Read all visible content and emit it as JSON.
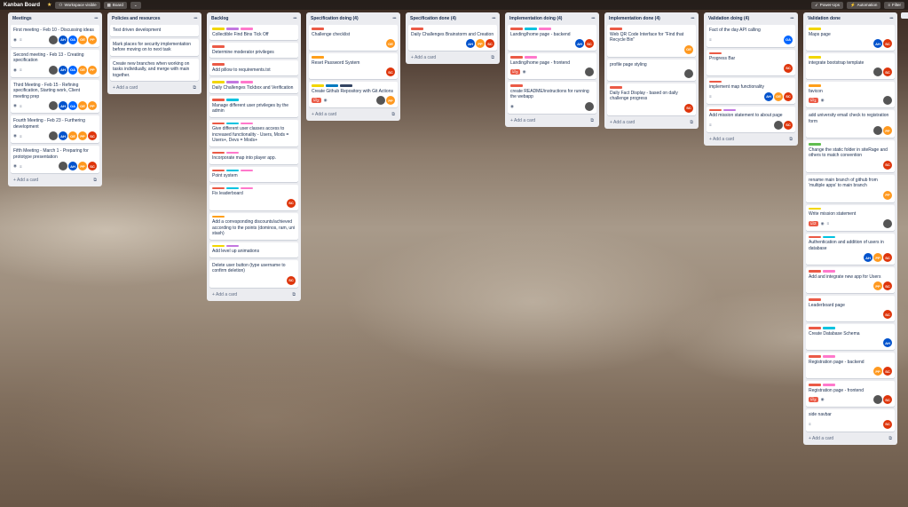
{
  "topbar": {
    "title": "Kanban Board",
    "workspace": "Workspace visible",
    "board": "Board",
    "powerups": "Power-Ups",
    "automation": "Automation",
    "filter": "Filter",
    "add": "+ A"
  },
  "labels": {
    "red": "#eb5a46",
    "yellow": "#f2d600",
    "purple": "#c377e0",
    "pink": "#ff78cb",
    "blue": "#0079bf",
    "sky": "#00c2e0",
    "green": "#61bd4f",
    "orange": "#ff9f1a",
    "black": "#344563"
  },
  "avatars": {
    "AH": "#0052cc",
    "OA": "#0065ff",
    "OE": "#ff991f",
    "PP": "#ff991f",
    "SC": "#de350b",
    "IMG": "#555555"
  },
  "add_label": "+ Add a card",
  "lists": [
    {
      "title": "Meetings",
      "cards": [
        {
          "labels": [],
          "text": "First meeting - Feb 10 - Discussing ideas",
          "badges": [
            "eye",
            "desc"
          ],
          "avatars": [
            "IMG",
            "AH",
            "OA",
            "OE",
            "PP"
          ]
        },
        {
          "labels": [],
          "text": "Second meeting - Feb 13 - Creating specification",
          "badges": [
            "eye",
            "desc"
          ],
          "avatars": [
            "IMG",
            "AH",
            "OA",
            "OE",
            "PP"
          ]
        },
        {
          "labels": [],
          "text": "Third Meeting - Feb 15 - Refining specification, Starting work, Client meeting prep",
          "badges": [
            "eye",
            "desc"
          ],
          "avatars": [
            "IMG",
            "AH",
            "OA",
            "OE",
            "PP"
          ]
        },
        {
          "labels": [],
          "text": "Fourth Meeting - Feb 23 - Furthering development",
          "badges": [
            "eye",
            "desc"
          ],
          "avatars": [
            "IMG",
            "AH",
            "OE",
            "PP",
            "SC"
          ]
        },
        {
          "labels": [],
          "text": "Fifth Meeting - March 1 - Preparing for prototype presentation",
          "badges": [
            "eye",
            "desc"
          ],
          "avatars": [
            "IMG",
            "AH",
            "PP",
            "SC"
          ]
        }
      ]
    },
    {
      "title": "Policies and resources",
      "cards": [
        {
          "labels": [],
          "text": "Test driven development",
          "badges": [],
          "avatars": []
        },
        {
          "labels": [],
          "text": "Mark places for security implementation before moving on to next task",
          "badges": [],
          "avatars": []
        },
        {
          "labels": [],
          "text": "Create new branches when working on tasks individually, and merge with main together.",
          "badges": [],
          "avatars": []
        }
      ]
    },
    {
      "title": "Backlog",
      "cards": [
        {
          "labels": [
            "yellow",
            "purple",
            "pink"
          ],
          "text": "Collectible Find Bins Tick Off",
          "badges": [],
          "avatars": []
        },
        {
          "labels": [
            "red"
          ],
          "text": "Determine moderator privileges",
          "badges": [],
          "avatars": []
        },
        {
          "labels": [
            "red"
          ],
          "text": "Add pillow to requirements.txt",
          "badges": [],
          "avatars": []
        },
        {
          "labels": [
            "yellow",
            "purple",
            "pink"
          ],
          "text": "Daily Challenges Tickbox and Verification",
          "badges": [],
          "avatars": []
        },
        {
          "labels": [
            "red",
            "sky"
          ],
          "text": "Manage different user privileges by the admin",
          "badges": [],
          "avatars": []
        },
        {
          "labels": [
            "red",
            "sky",
            "pink"
          ],
          "text": "Give different user classes access to increased functionality - Users, Mods = Users+, Devs = Mods+",
          "badges": [],
          "avatars": []
        },
        {
          "labels": [
            "red",
            "pink"
          ],
          "text": "Incorporate map into player app.",
          "badges": [],
          "avatars": []
        },
        {
          "labels": [
            "red",
            "sky",
            "pink"
          ],
          "text": "Point system",
          "badges": [],
          "avatars": []
        },
        {
          "labels": [
            "red",
            "sky",
            "pink"
          ],
          "text": "Fix leaderboard",
          "badges": [],
          "avatars": [
            "SC"
          ]
        },
        {
          "labels": [
            "orange"
          ],
          "text": "Add a corresponding discounts/achieved according to the points (dominos, ram, uni stash)",
          "badges": [],
          "avatars": []
        },
        {
          "labels": [
            "yellow",
            "purple"
          ],
          "text": "Add level up animations",
          "badges": [],
          "avatars": []
        },
        {
          "labels": [],
          "text": "Delete user button (type username to confirm deletion)",
          "badges": [],
          "avatars": [
            "SC"
          ]
        }
      ]
    },
    {
      "title": "Specification doing (4)",
      "cards": [
        {
          "labels": [
            "red"
          ],
          "text": "Challenge checklist",
          "badges": [],
          "avatars": [
            "OE"
          ]
        },
        {
          "labels": [
            "orange"
          ],
          "text": "Reset Password System",
          "badges": [],
          "avatars": [
            "SC"
          ]
        },
        {
          "labels": [
            "yellow",
            "blue",
            "black"
          ],
          "text": "Create Github Repository with Git Actions",
          "badges": [
            "c2",
            "eye"
          ],
          "avatars": [
            "IMG",
            "PP"
          ]
        }
      ]
    },
    {
      "title": "Specification done (4)",
      "cards": [
        {
          "labels": [
            "red"
          ],
          "text": "Daily Challenges Brainstorm and Creation",
          "badges": [],
          "avatars": [
            "AH",
            "PP",
            "SC"
          ]
        }
      ]
    },
    {
      "title": "Implementation doing (4)",
      "cards": [
        {
          "labels": [
            "red",
            "sky",
            "pink"
          ],
          "text": "Landing/home page - backend",
          "badges": [],
          "avatars": [
            "AH",
            "SC"
          ]
        },
        {
          "labels": [
            "red",
            "pink"
          ],
          "text": "Landing/home page - frontend",
          "badges": [
            "c3",
            "eye"
          ],
          "avatars": [
            "IMG"
          ]
        },
        {
          "labels": [
            "red"
          ],
          "text": "create README/instructions for running the webapp",
          "badges": [
            "eye"
          ],
          "avatars": [
            "IMG"
          ]
        }
      ]
    },
    {
      "title": "Implementation done (4)",
      "cards": [
        {
          "labels": [
            "red"
          ],
          "text": "Web QR Code Interface for \"Find that Recycle Bin\"",
          "badges": [],
          "avatars": [
            "OE"
          ]
        },
        {
          "labels": [],
          "text": "profile page styling",
          "badges": [],
          "avatars": [
            "IMG"
          ]
        },
        {
          "labels": [
            "red"
          ],
          "text": "Daily Fact Display - based on daily challenge progress",
          "badges": [],
          "avatars": [
            "SC"
          ]
        }
      ]
    },
    {
      "title": "Validation doing (4)",
      "cards": [
        {
          "labels": [],
          "text": "Fact of the day API calling",
          "badges": [
            "desc"
          ],
          "avatars": [
            "OA"
          ]
        },
        {
          "labels": [
            "red"
          ],
          "text": "Progress Bar",
          "badges": [],
          "avatars": [
            "SC"
          ]
        },
        {
          "labels": [
            "red"
          ],
          "text": "implement map functionality",
          "badges": [
            "desc"
          ],
          "avatars": [
            "AH",
            "OE",
            "SC"
          ]
        },
        {
          "labels": [
            "red",
            "purple"
          ],
          "text": "Add mission statement to about page",
          "badges": [
            "desc"
          ],
          "avatars": [
            "IMG",
            "SC"
          ]
        }
      ]
    },
    {
      "title": "Validation done",
      "cards": [
        {
          "labels": [
            "yellow"
          ],
          "text": "Maps page",
          "badges": [],
          "avatars": [
            "AH",
            "SC"
          ]
        },
        {
          "labels": [
            "yellow"
          ],
          "text": "integrate bootstrap template",
          "badges": [],
          "avatars": [
            "IMG",
            "SC"
          ]
        },
        {
          "labels": [
            "orange"
          ],
          "text": "favicon",
          "badges": [
            "c1",
            "eye"
          ],
          "avatars": [
            "IMG"
          ]
        },
        {
          "labels": [],
          "text": "add university email check to registration form",
          "badges": [],
          "avatars": [
            "IMG",
            "PP"
          ]
        },
        {
          "labels": [
            "green"
          ],
          "text": "Change the static folder in siteRage and others to match convention",
          "badges": [],
          "avatars": [
            "SC"
          ]
        },
        {
          "labels": [],
          "text": "rename main branch of github from 'multiple apps' to main branch",
          "badges": [],
          "avatars": [
            "PP"
          ]
        },
        {
          "labels": [
            "yellow"
          ],
          "text": "Write mission statement",
          "badges": [
            "c2",
            "eye",
            "desc"
          ],
          "avatars": [
            "IMG"
          ]
        },
        {
          "labels": [
            "red",
            "sky"
          ],
          "text": "Authentication and addition of users in database",
          "badges": [],
          "avatars": [
            "AH",
            "PP",
            "SC"
          ]
        },
        {
          "labels": [
            "red",
            "pink"
          ],
          "text": "Add and integrate new app for Users",
          "badges": [],
          "avatars": [
            "PP",
            "SC"
          ]
        },
        {
          "labels": [
            "red"
          ],
          "text": "Leaderboard page",
          "badges": [],
          "avatars": [
            "SC"
          ]
        },
        {
          "labels": [
            "red",
            "sky"
          ],
          "text": "Create Database Schema",
          "badges": [],
          "avatars": [
            "AH"
          ]
        },
        {
          "labels": [
            "red",
            "pink"
          ],
          "text": "Registration page - backend",
          "badges": [],
          "avatars": [
            "PP",
            "SC"
          ]
        },
        {
          "labels": [
            "red",
            "pink"
          ],
          "text": "Registration page - frontend",
          "badges": [
            "c2",
            "eye"
          ],
          "avatars": [
            "IMG",
            "SC"
          ]
        },
        {
          "labels": [],
          "text": "side navbar",
          "badges": [
            "desc"
          ],
          "avatars": [
            "SC"
          ]
        }
      ]
    }
  ]
}
